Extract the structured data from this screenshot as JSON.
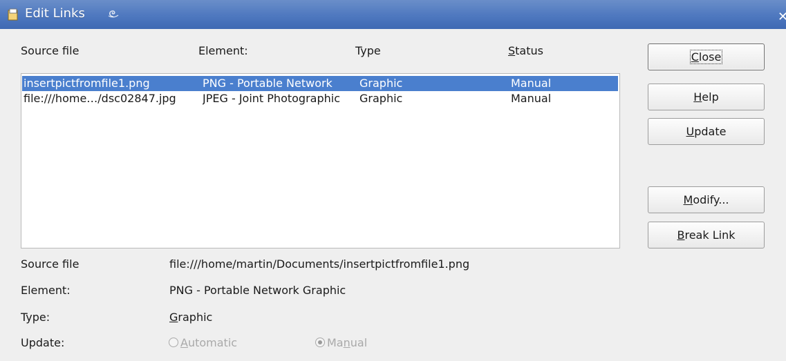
{
  "window": {
    "title": "Edit Links",
    "app_icon": "document-icon",
    "colors": {
      "titlebar": "#4e78bf",
      "selection": "#4a7fce"
    }
  },
  "table": {
    "headers": {
      "source": "Source file",
      "element": "Element:",
      "type": "Type",
      "status_prefix": "S",
      "status_rest": "tatus"
    },
    "rows": [
      {
        "source": "insertpictfromfile1.png",
        "element": "PNG - Portable Network",
        "type": "Graphic",
        "status": "Manual",
        "selected": true
      },
      {
        "source": "file:///home…/dsc02847.jpg",
        "element": "JPEG - Joint Photographic",
        "type": "Graphic",
        "status": "Manual",
        "selected": false
      }
    ]
  },
  "buttons": {
    "close": {
      "u": "C",
      "rest": "lose"
    },
    "help": {
      "u": "H",
      "rest": "elp"
    },
    "update": {
      "u": "U",
      "rest": "pdate"
    },
    "modify": {
      "u": "M",
      "rest": "odify..."
    },
    "break_link": {
      "u": "B",
      "rest": "reak Link"
    }
  },
  "details": {
    "source_label": "Source file",
    "source_value": "file:///home/martin/Documents/insertpictfromfile1.png",
    "element_label": "Element:",
    "element_value": "PNG - Portable Network Graphic",
    "type_label": "Type:",
    "type_u": "G",
    "type_rest": "raphic",
    "update_label": "Update:",
    "automatic": {
      "u": "A",
      "rest": "utomatic",
      "checked": false
    },
    "manual": {
      "pre": "Ma",
      "u": "n",
      "rest": "ual",
      "checked": true
    }
  }
}
